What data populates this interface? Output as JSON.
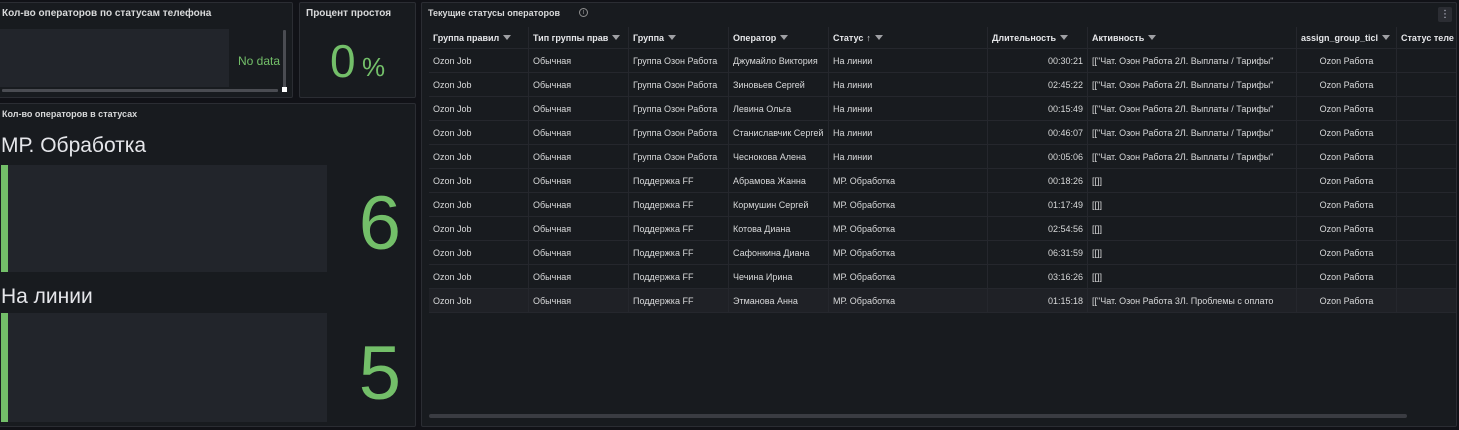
{
  "panel_phone": {
    "title": "Кол-во операторов по статусам телефона",
    "no_data": "No data"
  },
  "panel_idle": {
    "title": "Процент простоя",
    "value": "0",
    "unit": "%"
  },
  "panel_statuses": {
    "title": "Кол-во операторов в статусах",
    "items": [
      {
        "label": "МР. Обработка",
        "value": "6"
      },
      {
        "label": "На линии",
        "value": "5"
      }
    ],
    "accent": "#73bf69"
  },
  "table": {
    "title": "Текущие статусы операторов",
    "info_icon": "i",
    "menu_icon": "⋮",
    "sort_arrow": "↑",
    "columns": [
      "Группа правил",
      "Тип группы прав",
      "Группа",
      "Оператор",
      "Статус",
      "Длительность",
      "Активность",
      "assign_group_ticl",
      "Статус теле"
    ],
    "rows": [
      [
        "Ozon Job",
        "Обычная",
        "Группа Озон Работа",
        "Джумайло Виктория",
        "На линии",
        "00:30:21",
        "[[\"Чат. Озон Работа 2Л. Выплаты / Тарифы\"",
        "Ozon Работа",
        ""
      ],
      [
        "Ozon Job",
        "Обычная",
        "Группа Озон Работа",
        "Зиновьев Сергей",
        "На линии",
        "02:45:22",
        "[[\"Чат. Озон Работа 2Л. Выплаты / Тарифы\"",
        "Ozon Работа",
        ""
      ],
      [
        "Ozon Job",
        "Обычная",
        "Группа Озон Работа",
        "Левина Ольга",
        "На линии",
        "00:15:49",
        "[[\"Чат. Озон Работа 2Л. Выплаты / Тарифы\"",
        "Ozon Работа",
        ""
      ],
      [
        "Ozon Job",
        "Обычная",
        "Группа Озон Работа",
        "Станиславчик Сергей",
        "На линии",
        "00:46:07",
        "[[\"Чат. Озон Работа 2Л. Выплаты / Тарифы\"",
        "Ozon Работа",
        ""
      ],
      [
        "Ozon Job",
        "Обычная",
        "Группа Озон Работа",
        "Чеснокова Алена",
        "На линии",
        "00:05:06",
        "[[\"Чат. Озон Работа 2Л. Выплаты / Тарифы\"",
        "Ozon Работа",
        ""
      ],
      [
        "Ozon Job",
        "Обычная",
        "Поддержка FF",
        "Абрамова Жанна",
        "МР. Обработка",
        "00:18:26",
        "[[]]",
        "Ozon Работа",
        ""
      ],
      [
        "Ozon Job",
        "Обычная",
        "Поддержка FF",
        "Кормушин Сергей",
        "МР. Обработка",
        "01:17:49",
        "[[]]",
        "Ozon Работа",
        ""
      ],
      [
        "Ozon Job",
        "Обычная",
        "Поддержка FF",
        "Котова Диана",
        "МР. Обработка",
        "02:54:56",
        "[[]]",
        "Ozon Работа",
        ""
      ],
      [
        "Ozon Job",
        "Обычная",
        "Поддержка FF",
        "Сафонкина Диана",
        "МР. Обработка",
        "06:31:59",
        "[[]]",
        "Ozon Работа",
        ""
      ],
      [
        "Ozon Job",
        "Обычная",
        "Поддержка FF",
        "Чечина Ирина",
        "МР. Обработка",
        "03:16:26",
        "[[]]",
        "Ozon Работа",
        ""
      ],
      [
        "Ozon Job",
        "Обычная",
        "Поддержка FF",
        "Этманова Анна",
        "МР. Обработка",
        "01:15:18",
        "[[\"Чат. Озон Работа 3Л. Проблемы с оплато",
        "Ozon Работа",
        ""
      ]
    ]
  }
}
